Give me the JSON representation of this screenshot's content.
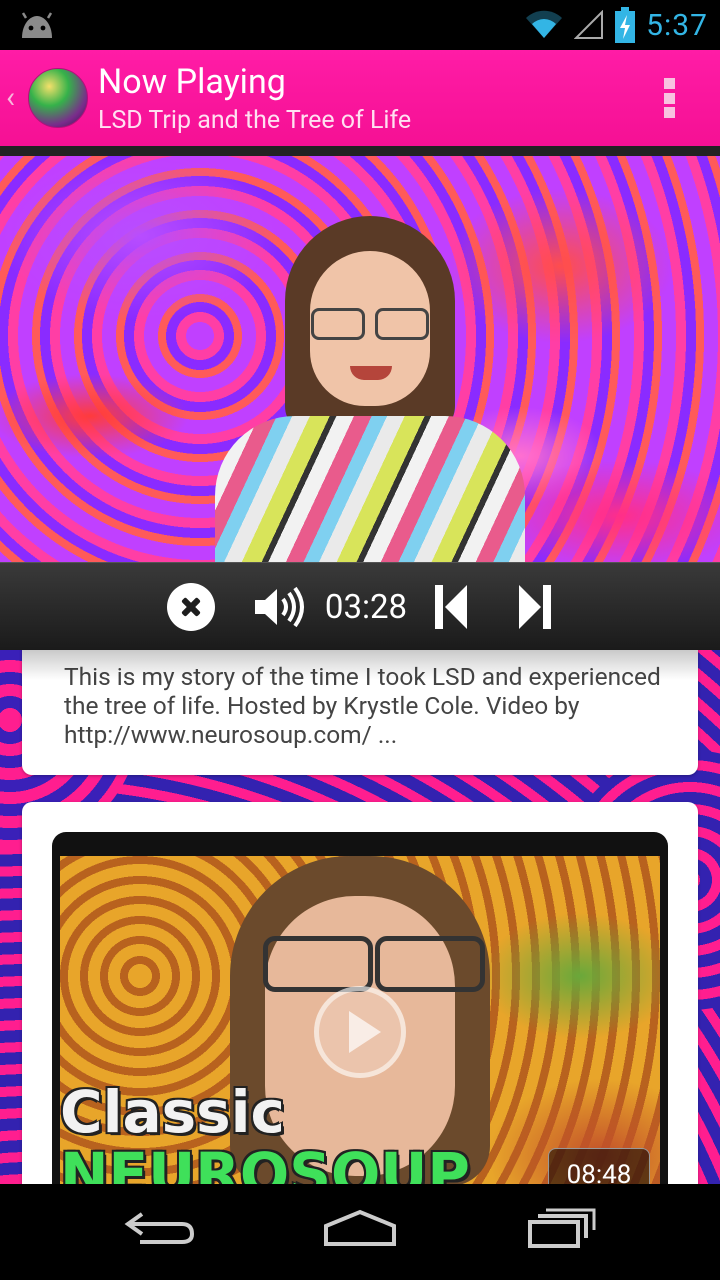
{
  "status_bar": {
    "time": "5:37",
    "icons": [
      "android-icon",
      "wifi-icon",
      "signal-icon",
      "battery-charging-icon"
    ],
    "clock_color": "#33b5e5"
  },
  "action_bar": {
    "title": "Now Playing",
    "subtitle": "LSD Trip and the Tree of Life",
    "background": "#ff1493",
    "back_glyph": "‹"
  },
  "player": {
    "time": "03:28",
    "controls": [
      "close-icon",
      "volume-icon",
      "previous-icon",
      "next-icon"
    ]
  },
  "description": {
    "text": "This is my story of the time I took LSD and experienced the tree of life.   Hosted by Krystle Cole. Video by http://www.neurosoup.com/ ..."
  },
  "next_video": {
    "thumb_text_line1": "Classic",
    "thumb_text_line2": "NEUROSOUP",
    "duration": "08:48"
  },
  "nav_bar": {
    "buttons": [
      "back-icon",
      "home-icon",
      "recent-apps-icon"
    ]
  }
}
